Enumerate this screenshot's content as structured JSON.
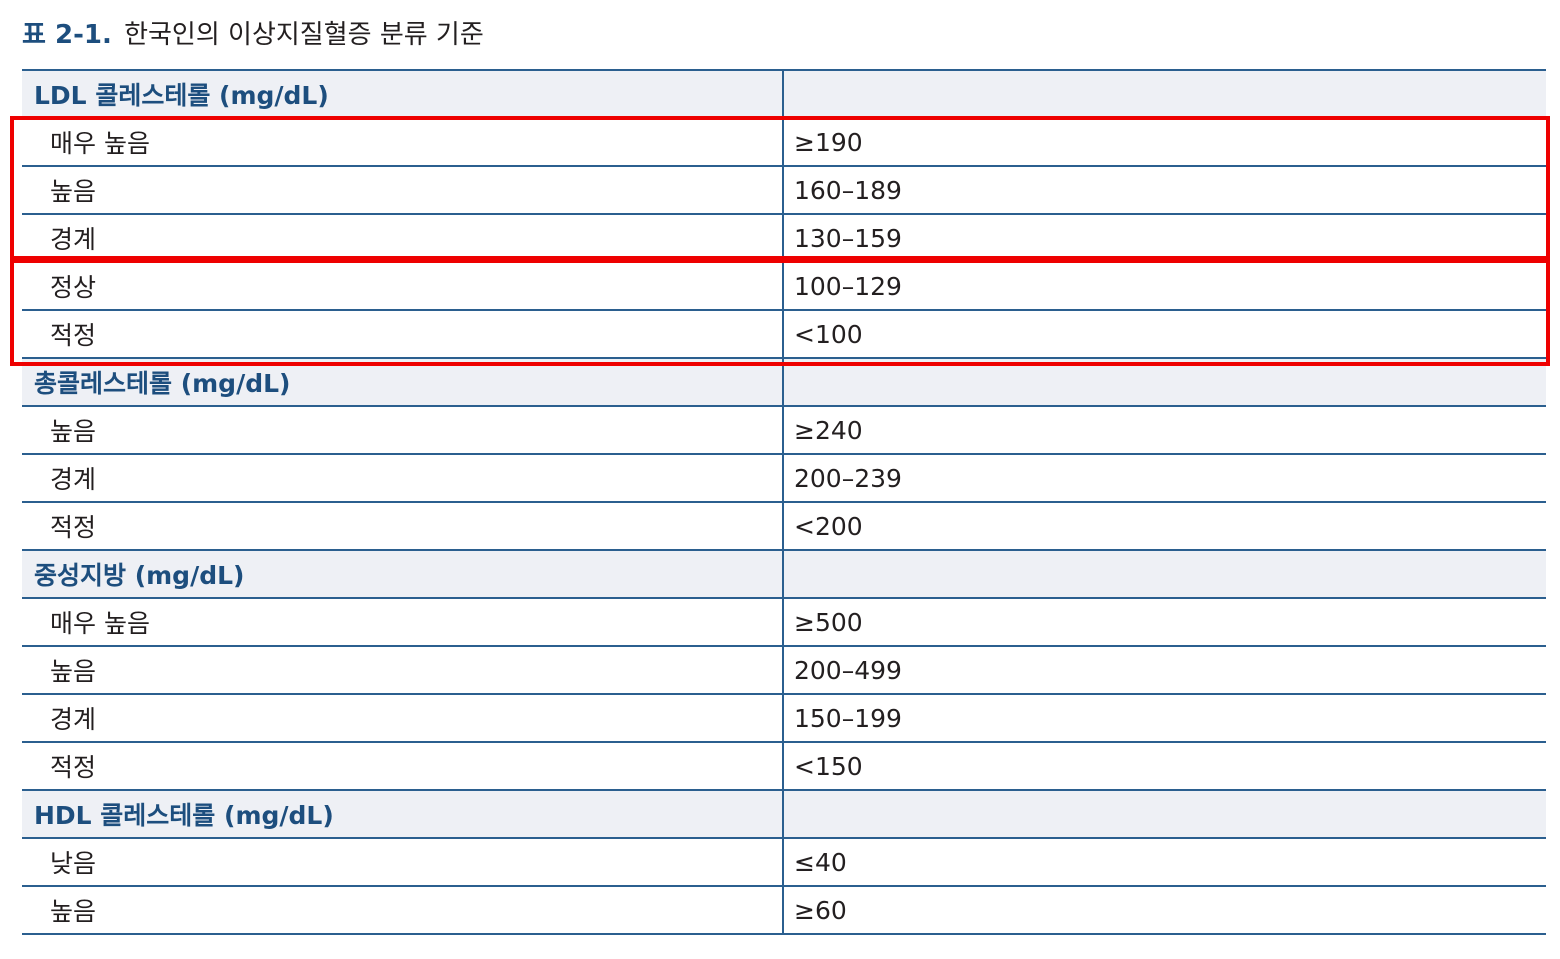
{
  "caption": {
    "number": "표 2-1.",
    "title": "한국인의 이상지질혈증 분류 기준"
  },
  "sections": [
    {
      "title": "LDL 콜레스테롤 (mg/dL)",
      "rows": [
        {
          "label": "매우 높음",
          "value": "≥190"
        },
        {
          "label": "높음",
          "value": "160–189"
        },
        {
          "label": "경계",
          "value": "130–159"
        },
        {
          "label": "정상",
          "value": "100–129"
        },
        {
          "label": "적정",
          "value": "<100"
        }
      ]
    },
    {
      "title": "총콜레스테롤 (mg/dL)",
      "rows": [
        {
          "label": "높음",
          "value": "≥240"
        },
        {
          "label": "경계",
          "value": "200–239"
        },
        {
          "label": "적정",
          "value": "<200"
        }
      ]
    },
    {
      "title": "중성지방 (mg/dL)",
      "rows": [
        {
          "label": "매우 높음",
          "value": "≥500"
        },
        {
          "label": "높음",
          "value": "200–499"
        },
        {
          "label": "경계",
          "value": "150–199"
        },
        {
          "label": "적정",
          "value": "<150"
        }
      ]
    },
    {
      "title": "HDL 콜레스테롤 (mg/dL)",
      "rows": [
        {
          "label": "낮음",
          "value": "≤40"
        },
        {
          "label": "높음",
          "value": "≥60"
        }
      ]
    }
  ],
  "colors": {
    "rule": "#2b5f8f",
    "header_bg": "#eef0f5",
    "header_text": "#1d4e7e",
    "highlight": "#ee0000"
  }
}
